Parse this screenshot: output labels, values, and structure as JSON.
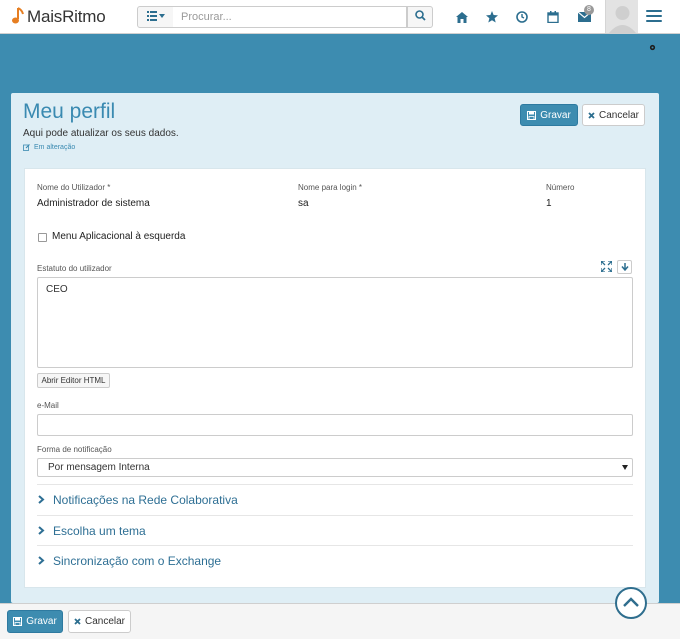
{
  "app": {
    "logo_text": "MaisRitmo"
  },
  "search": {
    "placeholder": "Procurar..."
  },
  "notifications": {
    "badge": "8"
  },
  "page": {
    "title": "Meu perfil",
    "subtitle": "Aqui pode atualizar os seus dados.",
    "edit_status": "Em alteração"
  },
  "actions": {
    "save_label": "Gravar",
    "cancel_label": "Cancelar"
  },
  "form": {
    "username_label": "Nome do Utilizador *",
    "username_value": "Administrador de sistema",
    "login_label": "Nome para login *",
    "login_value": "sa",
    "number_label": "Número",
    "number_value": "1",
    "left_menu_label": "Menu Aplicacional à esquerda",
    "left_menu_checked": false,
    "status_label": "Estatuto do utilizador",
    "status_value": "CEO",
    "html_editor_label": "Abrir Editor HTML",
    "email_label": "e-Mail",
    "email_value": "",
    "notify_label": "Forma de notificação",
    "notify_value": "Por mensagem Interna"
  },
  "sections": [
    {
      "label": "Notificações na Rede Colaborativa"
    },
    {
      "label": "Escolha um tema"
    },
    {
      "label": "Sincronização com o Exchange"
    }
  ],
  "colors": {
    "primary": "#3d8cb0",
    "page_bg": "#3d8cb0",
    "panel_bg": "#dfeef5",
    "link": "#2e6f94"
  },
  "icons": [
    "music-note-icon",
    "list-icon",
    "search-icon",
    "home-icon",
    "star-icon",
    "clock-icon",
    "calendar-icon",
    "envelope-icon",
    "user-avatar-icon",
    "hamburger-icon",
    "gear-icon",
    "save-icon",
    "close-icon",
    "expand-icon",
    "download-icon",
    "chevron-right-icon",
    "chevron-up-icon"
  ]
}
